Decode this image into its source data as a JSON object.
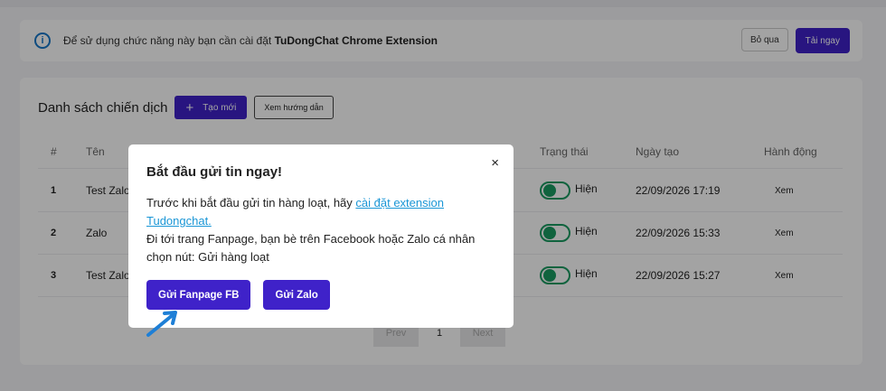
{
  "notice": {
    "text_prefix": "Để sử dụng chức năng này bạn cần cài đặt ",
    "text_strong": "TuDongChat Chrome Extension",
    "skip_label": "Bỏ qua",
    "download_label": "Tải ngay"
  },
  "panel": {
    "title": "Danh sách chiến dịch",
    "create_label": "Tạo mới",
    "guide_label": "Xem hướng dẫn"
  },
  "table": {
    "headers": [
      "#",
      "Tên",
      "Trạng thái",
      "Ngày tạo",
      "Hành động"
    ],
    "rows": [
      {
        "num": "1",
        "name": "Test Zalo",
        "status": "Hiện",
        "date": "22/09/2026 17:19",
        "action": "Xem"
      },
      {
        "num": "2",
        "name": "Zalo",
        "status": "Hiện",
        "date": "22/09/2026 15:33",
        "action": "Xem"
      },
      {
        "num": "3",
        "name": "Test Zalo",
        "status": "Hiện",
        "date": "22/09/2026 15:27",
        "action": "Xem"
      }
    ]
  },
  "pagination": {
    "prev": "Prev",
    "current": "1",
    "next": "Next"
  },
  "modal": {
    "title": "Bắt đầu gửi tin ngay!",
    "close": "×",
    "line1_prefix": "Trước khi bắt đầu gửi tin hàng loạt, hãy ",
    "line1_link": "cài đặt extension Tudongchat.",
    "line2": "Đi tới trang Fanpage, bạn bè trên Facebook hoặc Zalo cá nhân chọn nút: Gửi hàng loạt",
    "btn_fb": "Gửi Fanpage FB",
    "btn_zalo": "Gửi Zalo"
  },
  "colors": {
    "primary": "#3f22c9",
    "link": "#1a96d6",
    "toggle": "#1a9c62",
    "arrow": "#1e7fd6"
  },
  "icons": {
    "notice": "info-icon",
    "create": "plus-icon",
    "modal_close": "close-icon",
    "pointer": "arrow-icon"
  }
}
